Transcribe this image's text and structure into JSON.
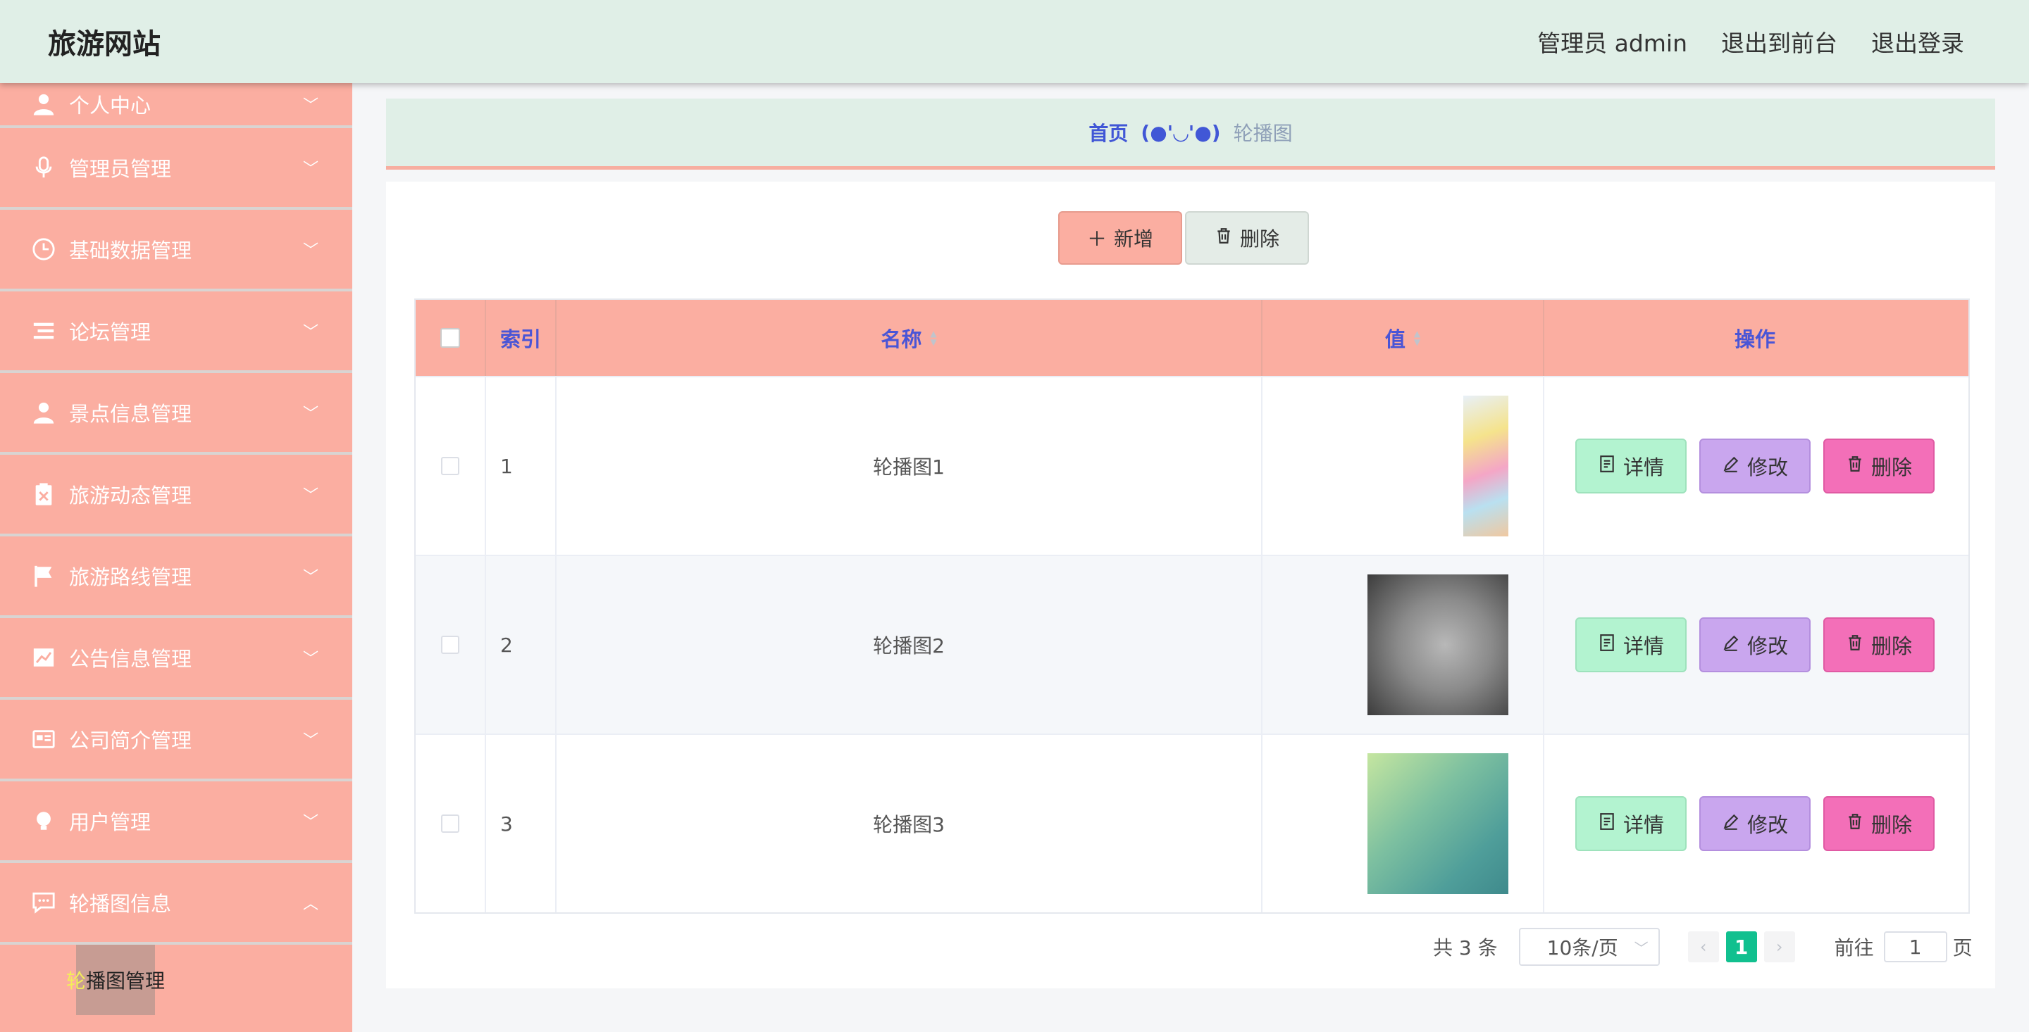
{
  "header": {
    "title": "旅游网站",
    "admin_label": "管理员 admin",
    "to_front_label": "退出到前台",
    "logout_label": "退出登录"
  },
  "sidebar": {
    "items": [
      {
        "label": "个人中心",
        "icon": "user-icon"
      },
      {
        "label": "管理员管理",
        "icon": "microphone-icon"
      },
      {
        "label": "基础数据管理",
        "icon": "clock-icon"
      },
      {
        "label": "论坛管理",
        "icon": "list-icon"
      },
      {
        "label": "景点信息管理",
        "icon": "user-icon"
      },
      {
        "label": "旅游动态管理",
        "icon": "clipboard-icon"
      },
      {
        "label": "旅游路线管理",
        "icon": "flag-icon"
      },
      {
        "label": "公告信息管理",
        "icon": "chart-icon"
      },
      {
        "label": "公司简介管理",
        "icon": "card-icon"
      },
      {
        "label": "用户管理",
        "icon": "bulb-icon"
      },
      {
        "label": "轮播图信息",
        "icon": "chat-icon"
      }
    ],
    "submenu": {
      "first_char": "轮",
      "rest": "播图管理"
    }
  },
  "breadcrumb": {
    "home": "首页",
    "separator": "(●'◡'●)",
    "current": "轮播图"
  },
  "toolbar": {
    "add_label": "新增",
    "delete_label": "删除"
  },
  "table": {
    "headers": {
      "index": "索引",
      "name": "名称",
      "value": "值",
      "actions": "操作"
    },
    "rows": [
      {
        "index": "1",
        "name": "轮播图1"
      },
      {
        "index": "2",
        "name": "轮播图2"
      },
      {
        "index": "3",
        "name": "轮播图3"
      }
    ],
    "actions": {
      "detail": "详情",
      "edit": "修改",
      "delete": "删除"
    }
  },
  "pagination": {
    "total": "共 3 条",
    "page_size": "10条/页",
    "current_page": "1",
    "goto_prefix": "前往",
    "goto_value": "1",
    "goto_suffix": "页"
  },
  "colors": {
    "header_bg": "#e0efe7",
    "sidebar_bg": "#fbaea1",
    "accent_blue": "#4157d6",
    "page_active": "#11c08f"
  }
}
